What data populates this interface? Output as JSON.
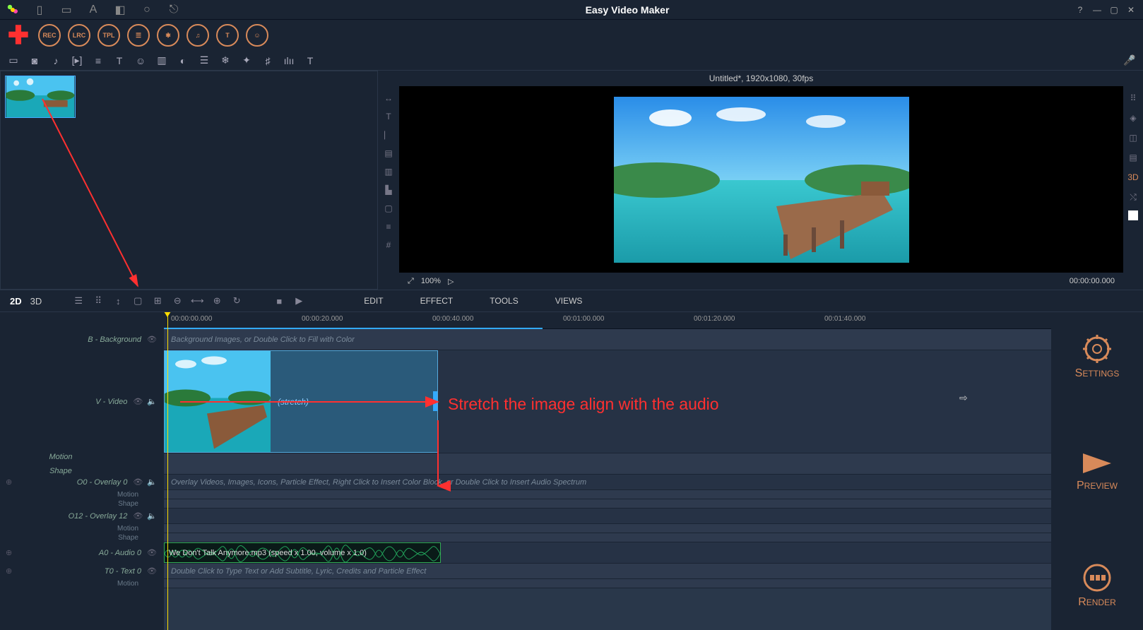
{
  "app": {
    "title": "Easy Video Maker"
  },
  "toolbar_circ": [
    "REC",
    "LRC",
    "TPL",
    "≡",
    "✱",
    "≡",
    "T",
    "☺"
  ],
  "preview": {
    "header": "Untitled*, 1920x1080, 30fps",
    "zoom": "100%",
    "timecode": "00:00:00.000"
  },
  "tabs": {
    "d2": "2D",
    "d3": "3D"
  },
  "menus": {
    "edit": "EDIT",
    "effect": "EFFECT",
    "tools": "TOOLS",
    "views": "VIEWS"
  },
  "ruler": [
    "00:00:00.000",
    "00:00:20.000",
    "00:00:40.000",
    "00:01:00.000",
    "00:01:20.000",
    "00:01:40.000"
  ],
  "tracks": {
    "background": {
      "label": "B - Background",
      "hint": "Background Images, or Double Click to Fill with Color"
    },
    "video": {
      "label": "V - Video",
      "stretch": "(stretch)"
    },
    "motion": {
      "label_a": "Motion",
      "label_b": "Shape"
    },
    "overlay0": {
      "label": "O0 - Overlay 0",
      "hint": "Overlay Videos, Images, Icons, Particle Effect, Right Click to Insert Color Block, or Double Click to Insert Audio Spectrum",
      "sub_a": "Motion",
      "sub_b": "Shape"
    },
    "overlay12": {
      "label": "O12 - Overlay 12",
      "sub_a": "Motion",
      "sub_b": "Shape"
    },
    "audio": {
      "label": "A0 - Audio 0",
      "clip": "We Don't Talk Anymore.mp3  (speed x 1.00, volume x 1.0)"
    },
    "text": {
      "label": "T0 - Text 0",
      "hint": "Double Click to Type Text or Add Subtitle, Lyric, Credits and Particle Effect",
      "sub_a": "Motion"
    }
  },
  "right_panel": {
    "settings": "ETTINGS",
    "preview": "REVIEW",
    "render": "ENDER"
  },
  "annotation": "Stretch the image align with the audio"
}
